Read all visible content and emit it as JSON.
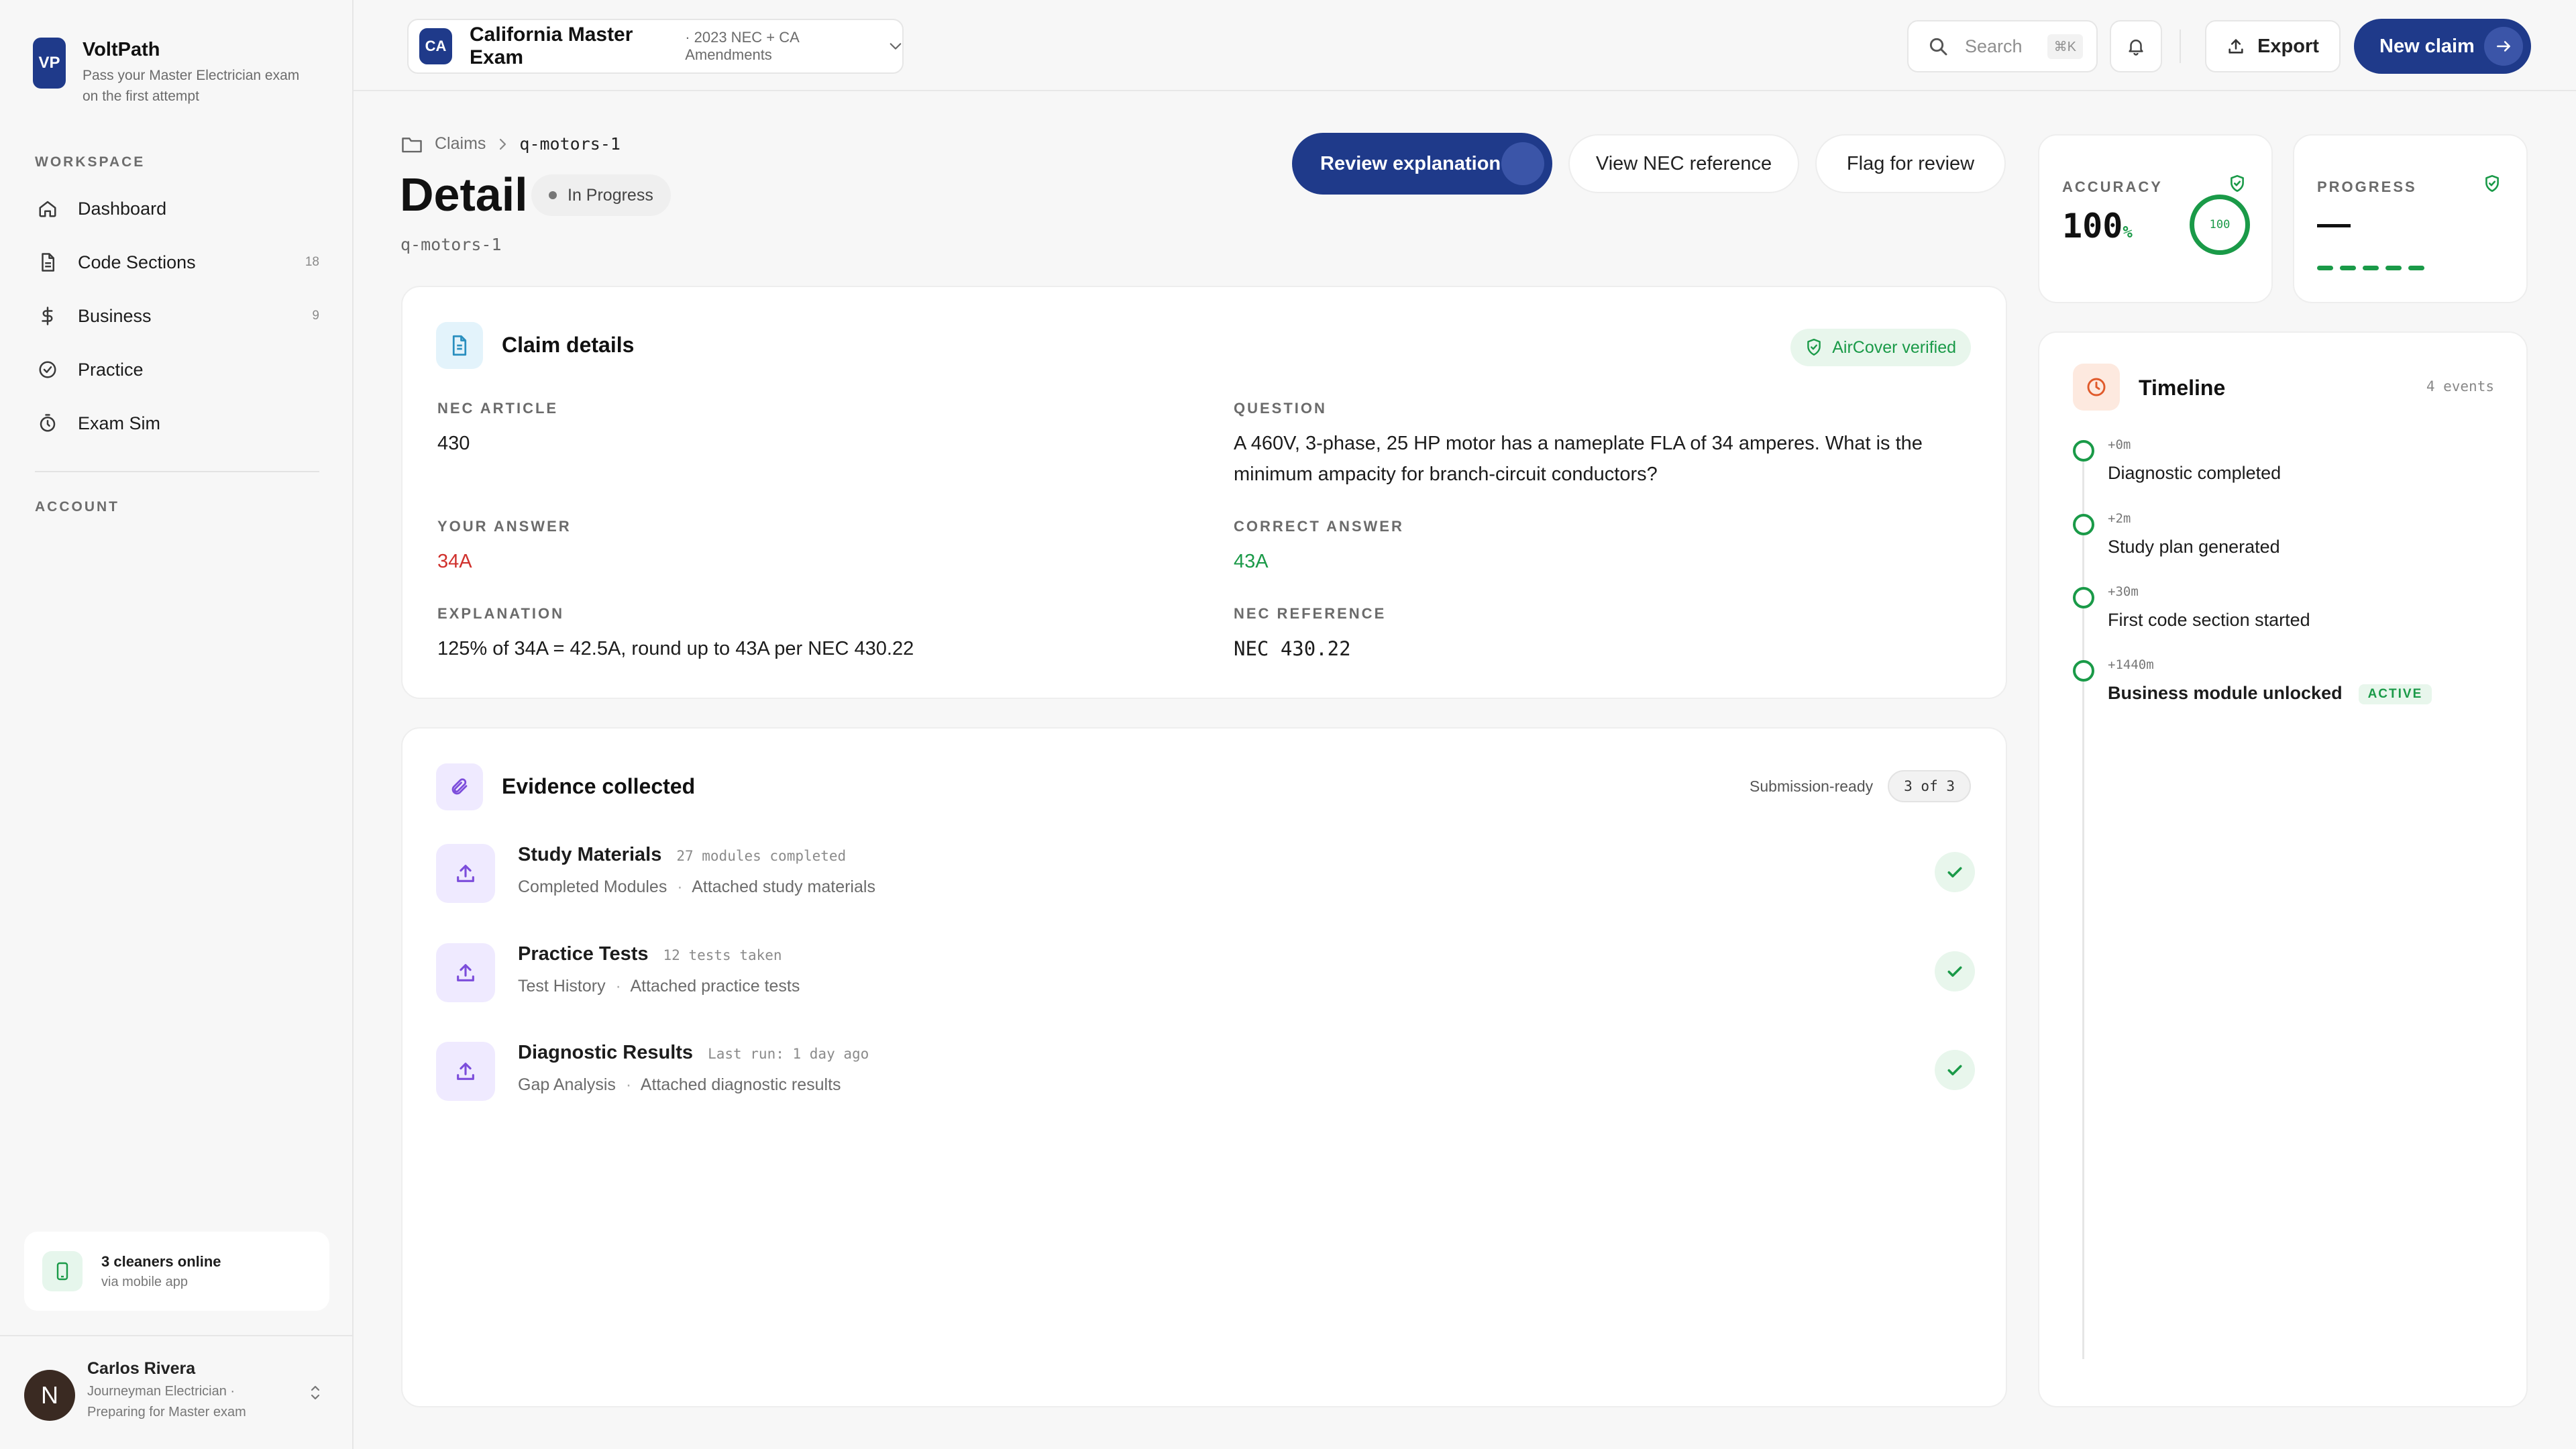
{
  "brand": {
    "logo": "VP",
    "name": "VoltPath",
    "tagline": "Pass your Master Electrician exam on the first attempt"
  },
  "sidebar": {
    "workspace_label": "WORKSPACE",
    "account_label": "ACCOUNT",
    "items": [
      {
        "label": "Dashboard",
        "icon": "home-icon",
        "count": ""
      },
      {
        "label": "Code Sections",
        "icon": "document-icon",
        "count": "18"
      },
      {
        "label": "Business",
        "icon": "dollar-icon",
        "count": "9"
      },
      {
        "label": "Practice",
        "icon": "check-circle-icon",
        "count": ""
      },
      {
        "label": "Exam Sim",
        "icon": "stopwatch-icon",
        "count": ""
      }
    ],
    "online": {
      "title": "3 cleaners online",
      "sub": "via mobile app"
    },
    "user": {
      "initial": "N",
      "name": "Carlos Rivera",
      "role": "Journeyman Electrician ·",
      "status": "Preparing for Master exam"
    }
  },
  "topbar": {
    "exam_badge": "CA",
    "exam_name": "California Master Exam",
    "exam_sub": "· 2023 NEC + CA Amendments",
    "search_placeholder": "Search",
    "search_shortcut": "⌘K",
    "export_label": "Export",
    "new_claim_label": "New claim"
  },
  "header": {
    "breadcrumb_root": "Claims",
    "breadcrumb_current": "q-motors-1",
    "title": "Detail",
    "status": "In Progress",
    "id": "q-motors-1",
    "actions": {
      "review": "Review explanation",
      "view_ref": "View NEC reference",
      "flag": "Flag for review"
    }
  },
  "claim": {
    "title": "Claim details",
    "verified": "AirCover verified",
    "nec_article_label": "NEC ARTICLE",
    "nec_article": "430",
    "question_label": "QUESTION",
    "question": "A 460V, 3-phase, 25 HP motor has a nameplate FLA of 34 amperes. What is the minimum ampacity for branch-circuit conductors?",
    "your_answer_label": "YOUR ANSWER",
    "your_answer": "34A",
    "correct_answer_label": "CORRECT ANSWER",
    "correct_answer": "43A",
    "explanation_label": "EXPLANATION",
    "explanation": "125% of 34A = 42.5A, round up to 43A per NEC 430.22",
    "nec_reference_label": "NEC REFERENCE",
    "nec_reference": "NEC 430.22"
  },
  "evidence": {
    "title": "Evidence collected",
    "status_label": "Submission-ready",
    "count": "3 of 3",
    "items": [
      {
        "title": "Study Materials",
        "meta": "27 modules completed",
        "category": "Completed Modules",
        "detail": "Attached study materials"
      },
      {
        "title": "Practice Tests",
        "meta": "12 tests taken",
        "category": "Test History",
        "detail": "Attached practice tests"
      },
      {
        "title": "Diagnostic Results",
        "meta": "Last run: 1 day ago",
        "category": "Gap Analysis",
        "detail": "Attached diagnostic results"
      }
    ]
  },
  "stats": {
    "accuracy_label": "ACCURACY",
    "accuracy_value": "100",
    "accuracy_unit": "%",
    "accuracy_ring": "100",
    "progress_label": "PROGRESS",
    "progress_value": "—"
  },
  "timeline": {
    "title": "Timeline",
    "count": "4 events",
    "events": [
      {
        "offset": "+0m",
        "text": "Diagnostic completed",
        "badge": ""
      },
      {
        "offset": "+2m",
        "text": "Study plan generated",
        "badge": ""
      },
      {
        "offset": "+30m",
        "text": "First code section started",
        "badge": ""
      },
      {
        "offset": "+1440m",
        "text": "Business module unlocked",
        "badge": "ACTIVE"
      }
    ]
  },
  "colors": {
    "brand": "#1f3a8a",
    "success": "#1a9a48",
    "error": "#d0312d",
    "evidence_accent": "#7c4ddb",
    "timeline_accent": "#e05a2b"
  }
}
